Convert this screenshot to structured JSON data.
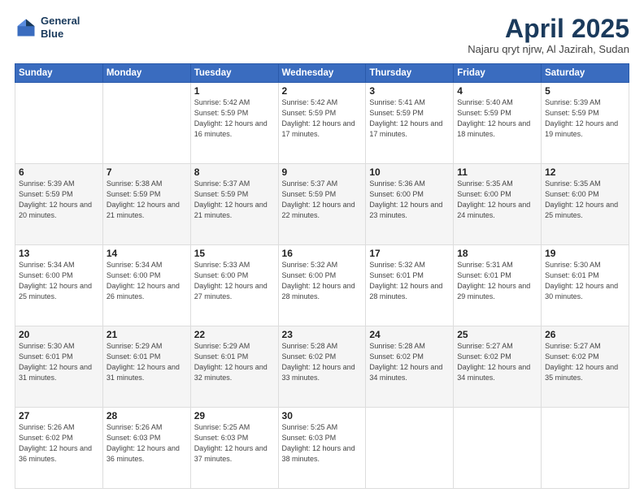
{
  "header": {
    "logo_line1": "General",
    "logo_line2": "Blue",
    "month_title": "April 2025",
    "location": "Najaru qryt njrw, Al Jazirah, Sudan"
  },
  "days_of_week": [
    "Sunday",
    "Monday",
    "Tuesday",
    "Wednesday",
    "Thursday",
    "Friday",
    "Saturday"
  ],
  "weeks": [
    [
      {
        "day": "",
        "sunrise": "",
        "sunset": "",
        "daylight": ""
      },
      {
        "day": "",
        "sunrise": "",
        "sunset": "",
        "daylight": ""
      },
      {
        "day": "1",
        "sunrise": "Sunrise: 5:42 AM",
        "sunset": "Sunset: 5:59 PM",
        "daylight": "Daylight: 12 hours and 16 minutes."
      },
      {
        "day": "2",
        "sunrise": "Sunrise: 5:42 AM",
        "sunset": "Sunset: 5:59 PM",
        "daylight": "Daylight: 12 hours and 17 minutes."
      },
      {
        "day": "3",
        "sunrise": "Sunrise: 5:41 AM",
        "sunset": "Sunset: 5:59 PM",
        "daylight": "Daylight: 12 hours and 17 minutes."
      },
      {
        "day": "4",
        "sunrise": "Sunrise: 5:40 AM",
        "sunset": "Sunset: 5:59 PM",
        "daylight": "Daylight: 12 hours and 18 minutes."
      },
      {
        "day": "5",
        "sunrise": "Sunrise: 5:39 AM",
        "sunset": "Sunset: 5:59 PM",
        "daylight": "Daylight: 12 hours and 19 minutes."
      }
    ],
    [
      {
        "day": "6",
        "sunrise": "Sunrise: 5:39 AM",
        "sunset": "Sunset: 5:59 PM",
        "daylight": "Daylight: 12 hours and 20 minutes."
      },
      {
        "day": "7",
        "sunrise": "Sunrise: 5:38 AM",
        "sunset": "Sunset: 5:59 PM",
        "daylight": "Daylight: 12 hours and 21 minutes."
      },
      {
        "day": "8",
        "sunrise": "Sunrise: 5:37 AM",
        "sunset": "Sunset: 5:59 PM",
        "daylight": "Daylight: 12 hours and 21 minutes."
      },
      {
        "day": "9",
        "sunrise": "Sunrise: 5:37 AM",
        "sunset": "Sunset: 5:59 PM",
        "daylight": "Daylight: 12 hours and 22 minutes."
      },
      {
        "day": "10",
        "sunrise": "Sunrise: 5:36 AM",
        "sunset": "Sunset: 6:00 PM",
        "daylight": "Daylight: 12 hours and 23 minutes."
      },
      {
        "day": "11",
        "sunrise": "Sunrise: 5:35 AM",
        "sunset": "Sunset: 6:00 PM",
        "daylight": "Daylight: 12 hours and 24 minutes."
      },
      {
        "day": "12",
        "sunrise": "Sunrise: 5:35 AM",
        "sunset": "Sunset: 6:00 PM",
        "daylight": "Daylight: 12 hours and 25 minutes."
      }
    ],
    [
      {
        "day": "13",
        "sunrise": "Sunrise: 5:34 AM",
        "sunset": "Sunset: 6:00 PM",
        "daylight": "Daylight: 12 hours and 25 minutes."
      },
      {
        "day": "14",
        "sunrise": "Sunrise: 5:34 AM",
        "sunset": "Sunset: 6:00 PM",
        "daylight": "Daylight: 12 hours and 26 minutes."
      },
      {
        "day": "15",
        "sunrise": "Sunrise: 5:33 AM",
        "sunset": "Sunset: 6:00 PM",
        "daylight": "Daylight: 12 hours and 27 minutes."
      },
      {
        "day": "16",
        "sunrise": "Sunrise: 5:32 AM",
        "sunset": "Sunset: 6:00 PM",
        "daylight": "Daylight: 12 hours and 28 minutes."
      },
      {
        "day": "17",
        "sunrise": "Sunrise: 5:32 AM",
        "sunset": "Sunset: 6:01 PM",
        "daylight": "Daylight: 12 hours and 28 minutes."
      },
      {
        "day": "18",
        "sunrise": "Sunrise: 5:31 AM",
        "sunset": "Sunset: 6:01 PM",
        "daylight": "Daylight: 12 hours and 29 minutes."
      },
      {
        "day": "19",
        "sunrise": "Sunrise: 5:30 AM",
        "sunset": "Sunset: 6:01 PM",
        "daylight": "Daylight: 12 hours and 30 minutes."
      }
    ],
    [
      {
        "day": "20",
        "sunrise": "Sunrise: 5:30 AM",
        "sunset": "Sunset: 6:01 PM",
        "daylight": "Daylight: 12 hours and 31 minutes."
      },
      {
        "day": "21",
        "sunrise": "Sunrise: 5:29 AM",
        "sunset": "Sunset: 6:01 PM",
        "daylight": "Daylight: 12 hours and 31 minutes."
      },
      {
        "day": "22",
        "sunrise": "Sunrise: 5:29 AM",
        "sunset": "Sunset: 6:01 PM",
        "daylight": "Daylight: 12 hours and 32 minutes."
      },
      {
        "day": "23",
        "sunrise": "Sunrise: 5:28 AM",
        "sunset": "Sunset: 6:02 PM",
        "daylight": "Daylight: 12 hours and 33 minutes."
      },
      {
        "day": "24",
        "sunrise": "Sunrise: 5:28 AM",
        "sunset": "Sunset: 6:02 PM",
        "daylight": "Daylight: 12 hours and 34 minutes."
      },
      {
        "day": "25",
        "sunrise": "Sunrise: 5:27 AM",
        "sunset": "Sunset: 6:02 PM",
        "daylight": "Daylight: 12 hours and 34 minutes."
      },
      {
        "day": "26",
        "sunrise": "Sunrise: 5:27 AM",
        "sunset": "Sunset: 6:02 PM",
        "daylight": "Daylight: 12 hours and 35 minutes."
      }
    ],
    [
      {
        "day": "27",
        "sunrise": "Sunrise: 5:26 AM",
        "sunset": "Sunset: 6:02 PM",
        "daylight": "Daylight: 12 hours and 36 minutes."
      },
      {
        "day": "28",
        "sunrise": "Sunrise: 5:26 AM",
        "sunset": "Sunset: 6:03 PM",
        "daylight": "Daylight: 12 hours and 36 minutes."
      },
      {
        "day": "29",
        "sunrise": "Sunrise: 5:25 AM",
        "sunset": "Sunset: 6:03 PM",
        "daylight": "Daylight: 12 hours and 37 minutes."
      },
      {
        "day": "30",
        "sunrise": "Sunrise: 5:25 AM",
        "sunset": "Sunset: 6:03 PM",
        "daylight": "Daylight: 12 hours and 38 minutes."
      },
      {
        "day": "",
        "sunrise": "",
        "sunset": "",
        "daylight": ""
      },
      {
        "day": "",
        "sunrise": "",
        "sunset": "",
        "daylight": ""
      },
      {
        "day": "",
        "sunrise": "",
        "sunset": "",
        "daylight": ""
      }
    ]
  ]
}
